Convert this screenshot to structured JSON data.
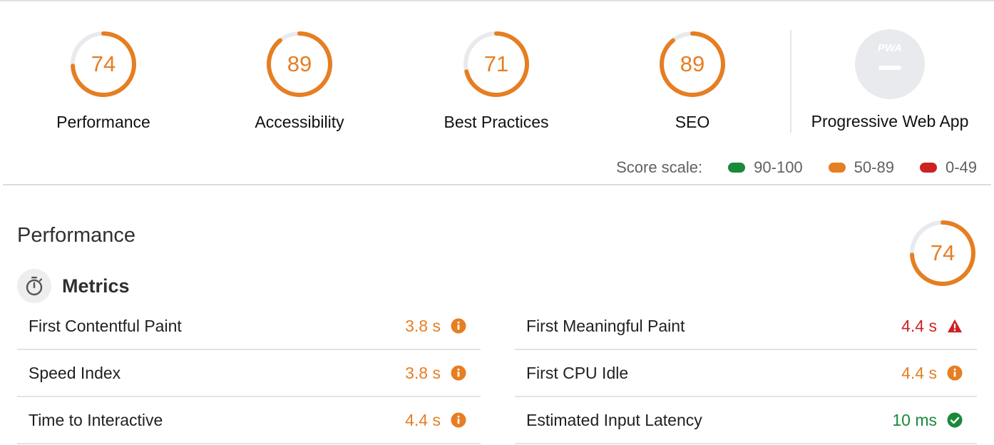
{
  "colors": {
    "average": "#e67e22",
    "pass": "#188a3a",
    "fail": "#cc2222",
    "track": "#e8eaed"
  },
  "categories": [
    {
      "label": "Performance",
      "score": 74
    },
    {
      "label": "Accessibility",
      "score": 89
    },
    {
      "label": "Best Practices",
      "score": 71
    },
    {
      "label": "SEO",
      "score": 89
    }
  ],
  "pwa": {
    "label": "Progressive Web App",
    "badge_text": "PWA",
    "icon": "pwa-badge-icon"
  },
  "score_scale": {
    "label": "Score scale:",
    "ranges": [
      {
        "label": "90-100",
        "color": "#188a3a"
      },
      {
        "label": "50-89",
        "color": "#e67e22"
      },
      {
        "label": "0-49",
        "color": "#cc2222"
      }
    ]
  },
  "performance_section": {
    "title": "Performance",
    "score": 74,
    "metrics_title": "Metrics",
    "metrics_icon": "stopwatch-icon",
    "metrics": [
      {
        "label": "First Contentful Paint",
        "value": "3.8 s",
        "status": "average",
        "icon": "info-icon"
      },
      {
        "label": "First Meaningful Paint",
        "value": "4.4 s",
        "status": "fail",
        "icon": "warning-triangle-icon"
      },
      {
        "label": "Speed Index",
        "value": "3.8 s",
        "status": "average",
        "icon": "info-icon"
      },
      {
        "label": "First CPU Idle",
        "value": "4.4 s",
        "status": "average",
        "icon": "info-icon"
      },
      {
        "label": "Time to Interactive",
        "value": "4.4 s",
        "status": "average",
        "icon": "info-icon"
      },
      {
        "label": "Estimated Input Latency",
        "value": "10 ms",
        "status": "pass",
        "icon": "check-circle-icon"
      }
    ]
  }
}
